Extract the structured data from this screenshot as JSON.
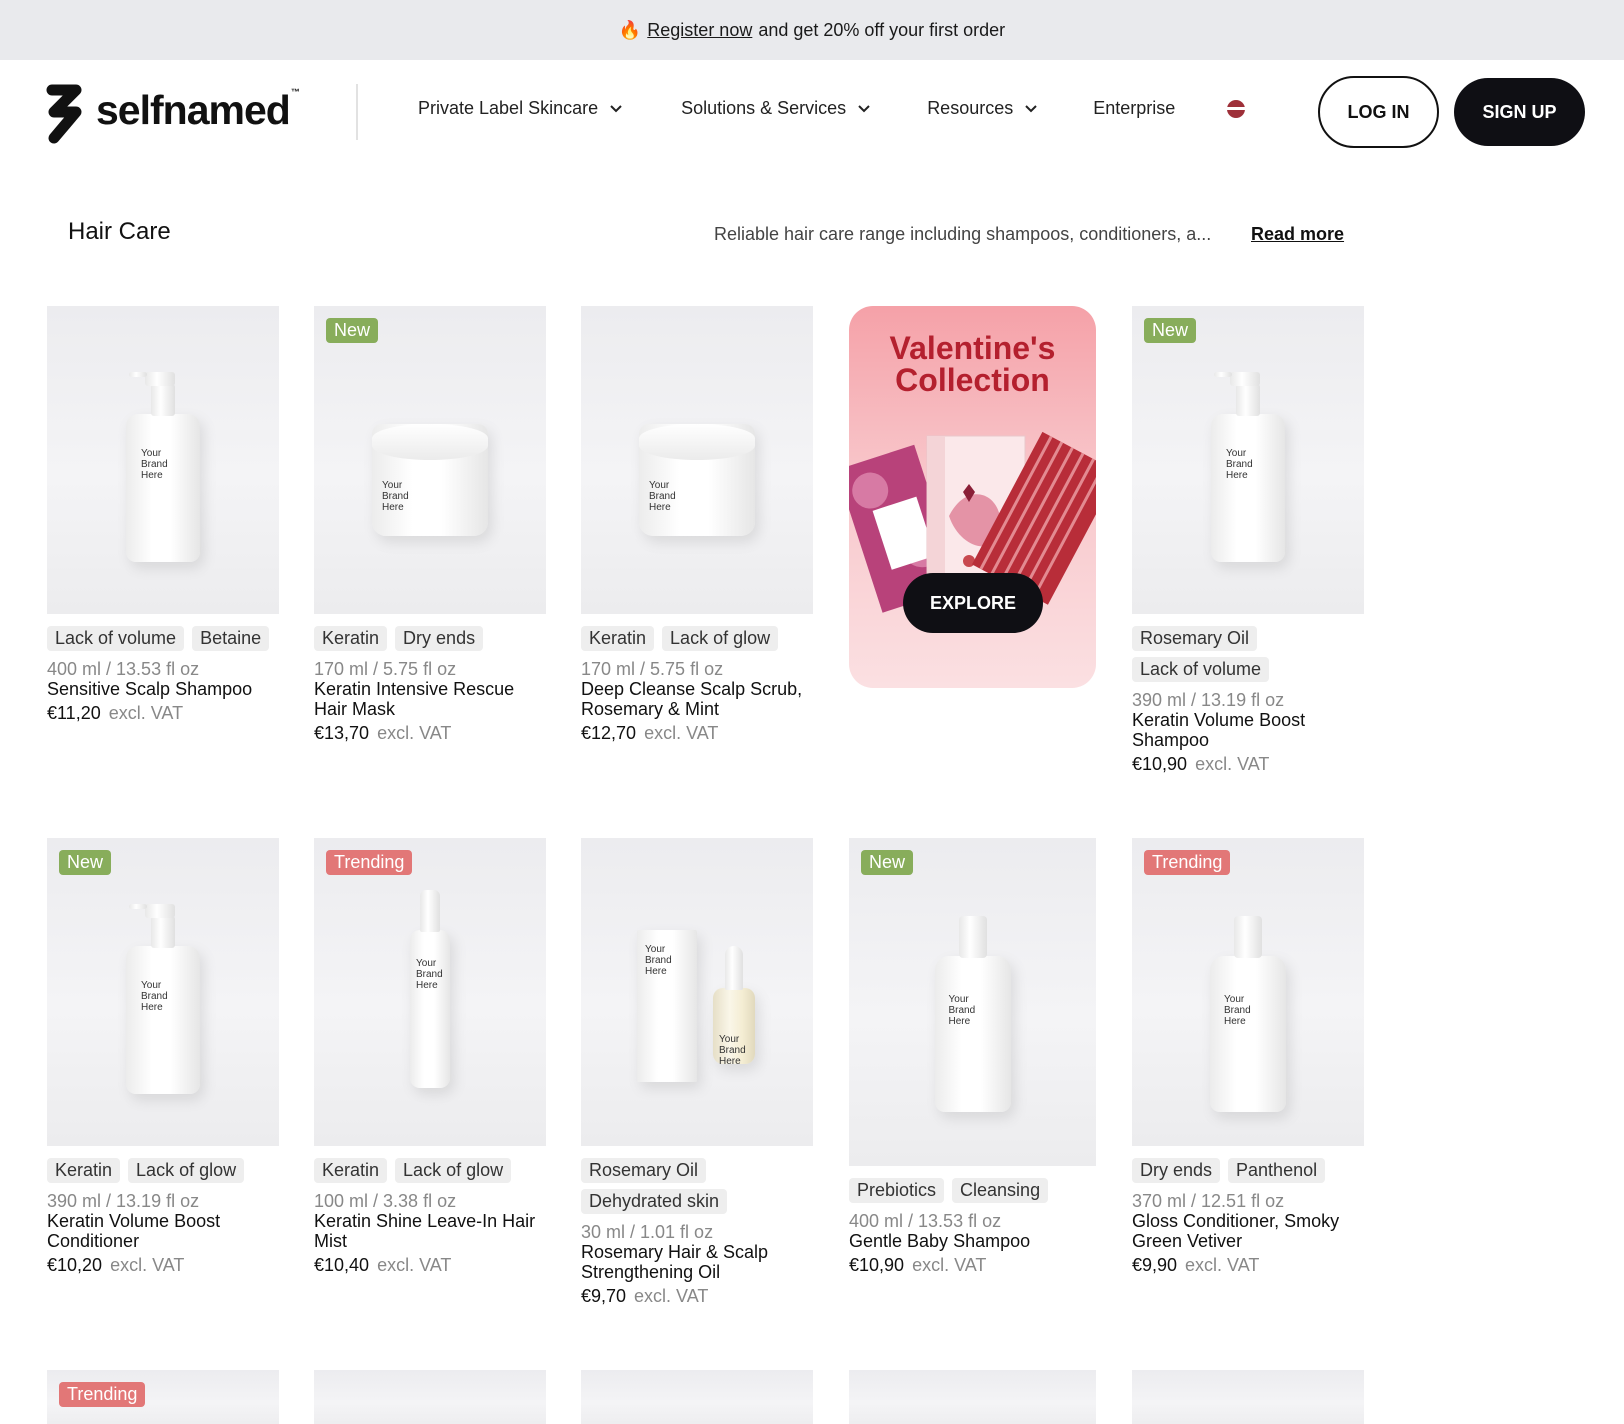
{
  "announcement": {
    "fire_icon": "🔥",
    "link_text": "Register now",
    "text": "and get 20% off your first order"
  },
  "header": {
    "logo_text": "selfnamed",
    "logo_tm": "™",
    "nav": [
      {
        "label": "Private Label Skincare",
        "has_dropdown": true
      },
      {
        "label": "Solutions & Services",
        "has_dropdown": true
      },
      {
        "label": "Resources",
        "has_dropdown": true
      },
      {
        "label": "Enterprise",
        "has_dropdown": false
      }
    ],
    "flag_colors": [
      "#9e3039",
      "#ffffff",
      "#9e3039"
    ],
    "login_label": "LOG IN",
    "signup_label": "SIGN UP"
  },
  "category": {
    "title": "Hair Care",
    "description": "Reliable hair care range including shampoos, conditioners, a...",
    "read_more": "Read more"
  },
  "promo": {
    "title_line1": "Valentine's",
    "title_line2": "Collection",
    "button": "EXPLORE"
  },
  "products": [
    {
      "badge": "",
      "tags": [
        "Lack of volume",
        "Betaine"
      ],
      "size": "400 ml / 13.53 fl oz",
      "name": "Sensitive Scalp Shampoo",
      "price": "€11,20",
      "vat": "excl. VAT",
      "type": "pump"
    },
    {
      "badge": "New",
      "tags": [
        "Keratin",
        "Dry ends"
      ],
      "size": "170 ml / 5.75 fl oz",
      "name": "Keratin Intensive Rescue Hair Mask",
      "price": "€13,70",
      "vat": "excl. VAT",
      "type": "jar"
    },
    {
      "badge": "",
      "tags": [
        "Keratin",
        "Lack of glow"
      ],
      "size": "170 ml / 5.75 fl oz",
      "name": "Deep Cleanse Scalp Scrub, Rosemary & Mint",
      "price": "€12,70",
      "vat": "excl. VAT",
      "type": "jar"
    },
    {
      "badge": "New",
      "tags": [
        "Rosemary Oil",
        "Lack of volume"
      ],
      "size": "390 ml / 13.19 fl oz",
      "name": "Keratin Volume Boost Shampoo",
      "price": "€10,90",
      "vat": "excl. VAT",
      "type": "pump"
    },
    {
      "badge": "New",
      "tags": [
        "Keratin",
        "Lack of glow"
      ],
      "size": "390 ml / 13.19 fl oz",
      "name": "Keratin Volume Boost Conditioner",
      "price": "€10,20",
      "vat": "excl. VAT",
      "type": "pump"
    },
    {
      "badge": "Trending",
      "tags": [
        "Keratin",
        "Lack of glow"
      ],
      "size": "100 ml / 3.38 fl oz",
      "name": "Keratin Shine Leave-In Hair Mist",
      "price": "€10,40",
      "vat": "excl. VAT",
      "type": "spray"
    },
    {
      "badge": "",
      "tags": [
        "Rosemary Oil",
        "Dehydrated skin"
      ],
      "size": "30 ml / 1.01 fl oz",
      "name": "Rosemary Hair & Scalp Strengthening Oil",
      "price": "€9,70",
      "vat": "excl. VAT",
      "type": "dropper"
    },
    {
      "badge": "New",
      "tags": [
        "Prebiotics",
        "Cleansing"
      ],
      "size": "400 ml / 13.53 fl oz",
      "name": "Gentle Baby Shampoo",
      "price": "€10,90",
      "vat": "excl. VAT",
      "type": "bottle"
    },
    {
      "badge": "Trending",
      "tags": [
        "Dry ends",
        "Panthenol"
      ],
      "size": "370 ml / 12.51 fl oz",
      "name": "Gloss Conditioner, Smoky Green Vetiver",
      "price": "€9,90",
      "vat": "excl. VAT",
      "type": "bottle"
    },
    {
      "badge": "Trending",
      "tags": [],
      "size": "",
      "name": "",
      "price": "",
      "vat": "",
      "type": "none"
    }
  ],
  "product_label": "Your Brand Here"
}
